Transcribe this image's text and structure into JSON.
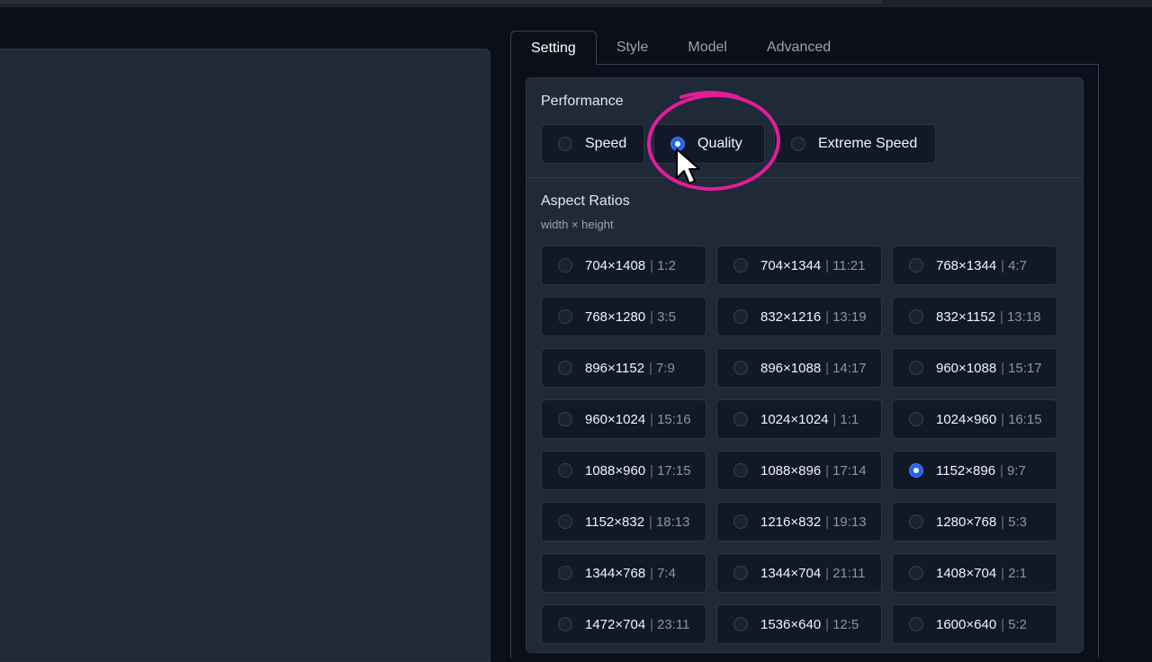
{
  "tabs": [
    {
      "label": "Setting",
      "active": true
    },
    {
      "label": "Style",
      "active": false
    },
    {
      "label": "Model",
      "active": false
    },
    {
      "label": "Advanced",
      "active": false
    }
  ],
  "performance": {
    "title": "Performance",
    "options": [
      {
        "label": "Speed",
        "selected": false
      },
      {
        "label": "Quality",
        "selected": true
      },
      {
        "label": "Extreme Speed",
        "selected": false
      }
    ]
  },
  "aspect_ratios": {
    "title": "Aspect Ratios",
    "subtitle": "width × height",
    "options": [
      {
        "size": "704×1408",
        "ratio": "1:2",
        "selected": false
      },
      {
        "size": "704×1344",
        "ratio": "11:21",
        "selected": false
      },
      {
        "size": "768×1344",
        "ratio": "4:7",
        "selected": false
      },
      {
        "size": "768×1280",
        "ratio": "3:5",
        "selected": false
      },
      {
        "size": "832×1216",
        "ratio": "13:19",
        "selected": false
      },
      {
        "size": "832×1152",
        "ratio": "13:18",
        "selected": false
      },
      {
        "size": "896×1152",
        "ratio": "7:9",
        "selected": false
      },
      {
        "size": "896×1088",
        "ratio": "14:17",
        "selected": false
      },
      {
        "size": "960×1088",
        "ratio": "15:17",
        "selected": false
      },
      {
        "size": "960×1024",
        "ratio": "15:16",
        "selected": false
      },
      {
        "size": "1024×1024",
        "ratio": "1:1",
        "selected": false
      },
      {
        "size": "1024×960",
        "ratio": "16:15",
        "selected": false
      },
      {
        "size": "1088×960",
        "ratio": "17:15",
        "selected": false
      },
      {
        "size": "1088×896",
        "ratio": "17:14",
        "selected": false
      },
      {
        "size": "1152×896",
        "ratio": "9:7",
        "selected": true
      },
      {
        "size": "1152×832",
        "ratio": "18:13",
        "selected": false
      },
      {
        "size": "1216×832",
        "ratio": "19:13",
        "selected": false
      },
      {
        "size": "1280×768",
        "ratio": "5:3",
        "selected": false
      },
      {
        "size": "1344×768",
        "ratio": "7:4",
        "selected": false
      },
      {
        "size": "1344×704",
        "ratio": "21:11",
        "selected": false
      },
      {
        "size": "1408×704",
        "ratio": "2:1",
        "selected": false
      },
      {
        "size": "1472×704",
        "ratio": "23:11",
        "selected": false
      },
      {
        "size": "1536×640",
        "ratio": "12:5",
        "selected": false
      },
      {
        "size": "1600×640",
        "ratio": "5:2",
        "selected": false
      }
    ]
  },
  "colors": {
    "accent": "#2563eb",
    "annotation": "#e11d9a"
  },
  "icons": {
    "cursor": "mouse-pointer-icon",
    "annotation": "highlight-circle-icon"
  }
}
